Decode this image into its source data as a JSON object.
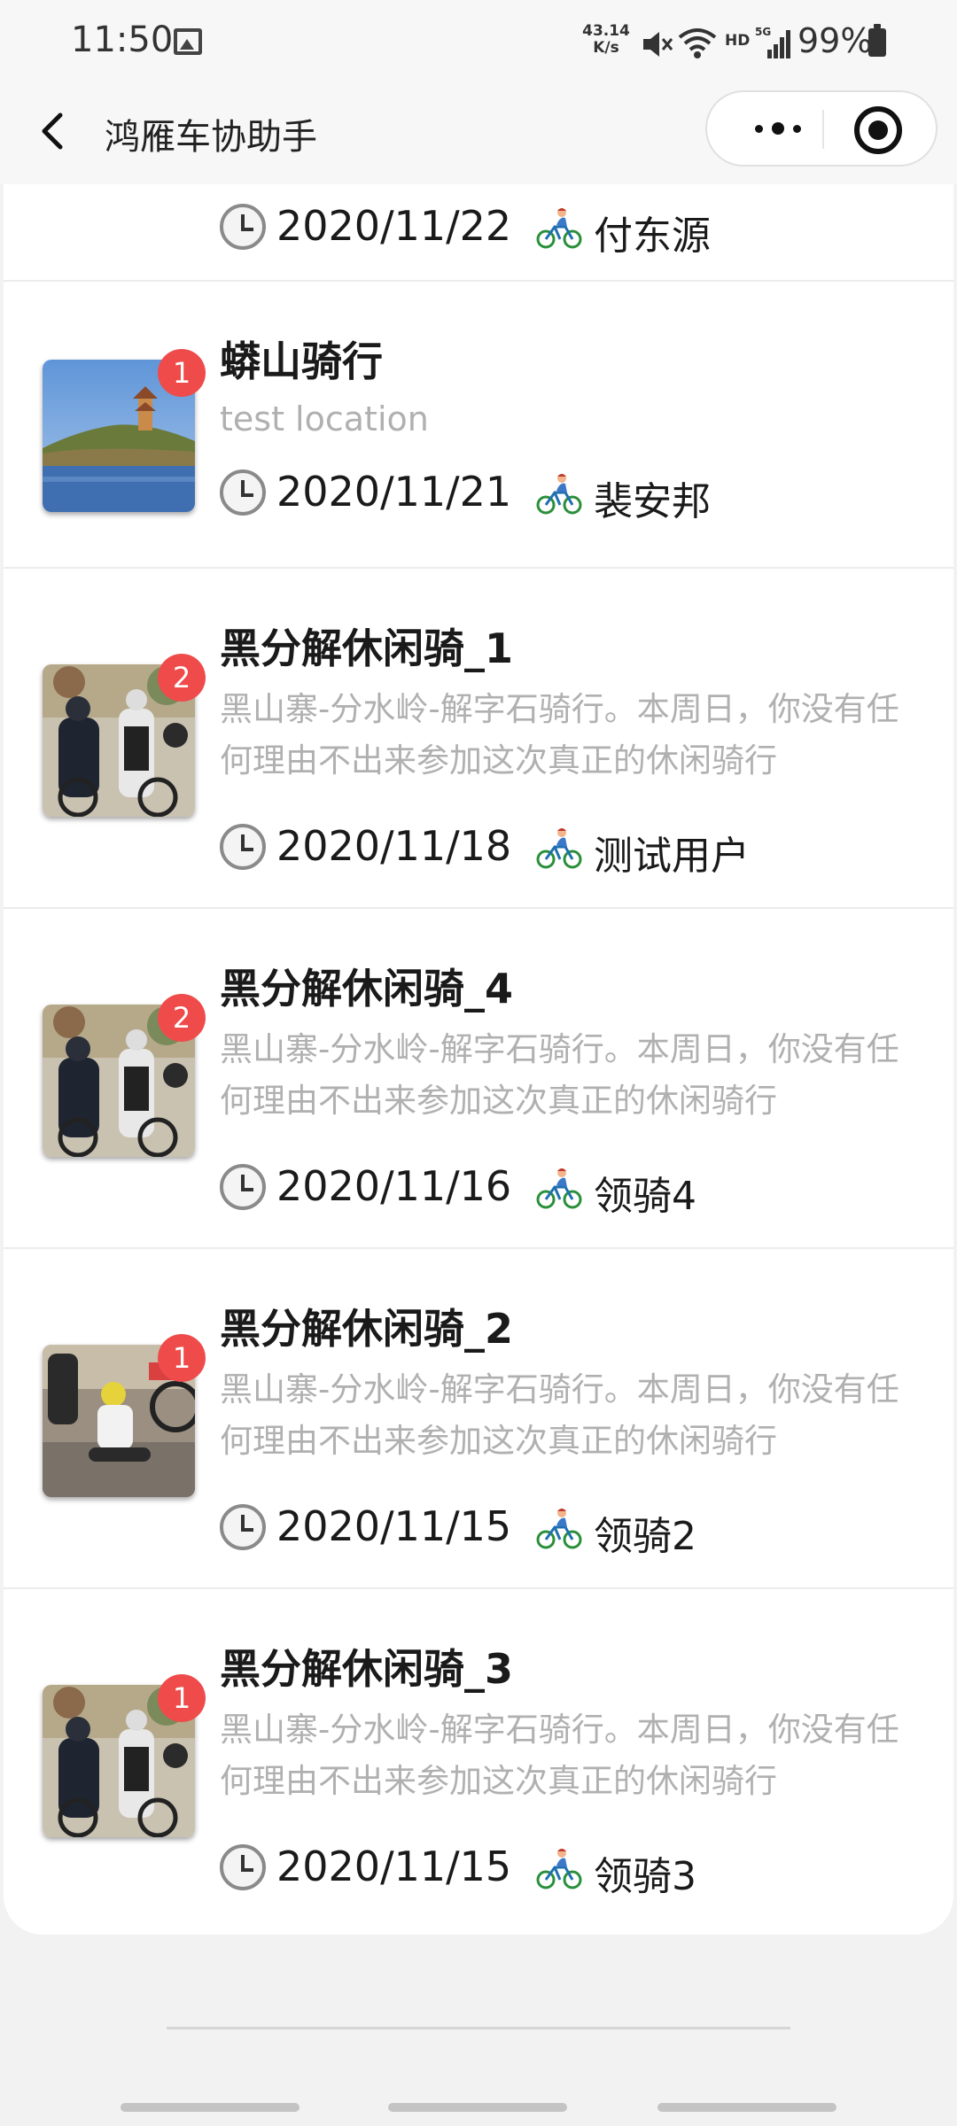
{
  "status_bar": {
    "time": "11:50",
    "net_speed_value": "43.14",
    "net_speed_unit": "K/s",
    "hd_label": "HD",
    "network_type": "5G",
    "battery": "99%"
  },
  "nav": {
    "title": "鸿雁车协助手"
  },
  "items": [
    {
      "title": "",
      "description": "",
      "date": "2020/11/22",
      "author": "付东源",
      "badge": "",
      "image": "black-brush-thumbnail"
    },
    {
      "title": "蟒山骑行",
      "description": "test location",
      "date": "2020/11/21",
      "author": "裴安邦",
      "badge": "1",
      "image": "lake-pagoda-photo"
    },
    {
      "title": "黑分解休闲骑_1",
      "description": "黑山寨-分水岭-解字石骑行。本周日，你没有任何理由不出来参加这次真正的休闲骑行",
      "date": "2020/11/18",
      "author": "测试用户",
      "badge": "2",
      "image": "cyclists-group-photo"
    },
    {
      "title": "黑分解休闲骑_4",
      "description": "黑山寨-分水岭-解字石骑行。本周日，你没有任何理由不出来参加这次真正的休闲骑行",
      "date": "2020/11/16",
      "author": "领骑4",
      "badge": "2",
      "image": "cyclists-group-photo"
    },
    {
      "title": "黑分解休闲骑_2",
      "description": "黑山寨-分水岭-解字石骑行。本周日，你没有任何理由不出来参加这次真正的休闲骑行",
      "date": "2020/11/15",
      "author": "领骑2",
      "badge": "1",
      "image": "cyclist-resting-photo"
    },
    {
      "title": "黑分解休闲骑_3",
      "description": "黑山寨-分水岭-解字石骑行。本周日，你没有任何理由不出来参加这次真正的休闲骑行",
      "date": "2020/11/15",
      "author": "领骑3",
      "badge": "1",
      "image": "cyclists-group-photo"
    }
  ],
  "colors": {
    "badge": "#ef4b4b",
    "description_text": "#b0b0b0",
    "page_background": "#f2f2f2"
  }
}
